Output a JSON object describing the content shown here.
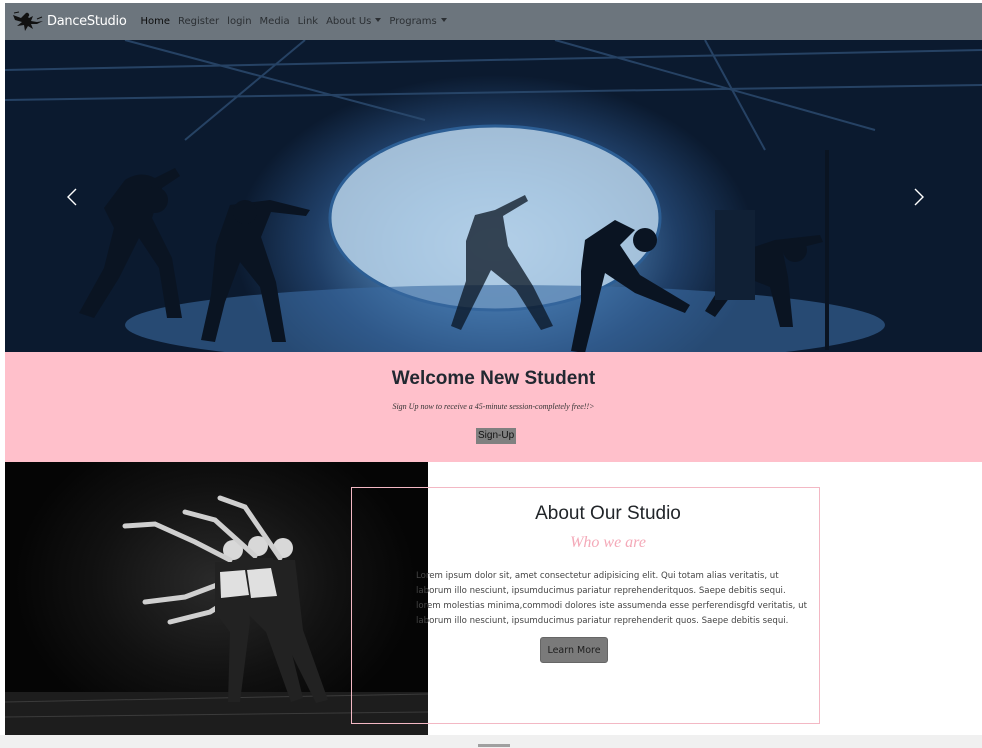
{
  "navbar": {
    "brand": "DanceStudio",
    "logo_icon": "dancer-logo-icon",
    "items": [
      {
        "label": "Home",
        "active": true
      },
      {
        "label": "Register"
      },
      {
        "label": "login"
      },
      {
        "label": "Media"
      },
      {
        "label": "Link"
      },
      {
        "label": "About Us",
        "dropdown": true
      },
      {
        "label": "Programs",
        "dropdown": true
      }
    ]
  },
  "carousel": {
    "prev_icon": "chevron-left-icon",
    "next_icon": "chevron-right-icon"
  },
  "welcome": {
    "title": "Welcome New Student",
    "subtitle": "Sign Up now to receive a 45-minute session-completely free!!>",
    "button": "Sign-Up",
    "bg_color": "#ffc0cb"
  },
  "about": {
    "title": "About Our Studio",
    "subtitle": "Who we are",
    "body_lines": [
      "Lorem ipsum dolor sit, amet consectetur adipisicing elit. Qui totam alias veritatis, ut",
      "laborum illo nesciunt, ipsumducimus pariatur reprehenderitquos. Saepe debitis sequi.",
      "lorem molestias minima,commodi dolores iste assumenda esse perferendisgfd veritatis, ut",
      "laborum illo nesciunt, ipsumducimus pariatur reprehenderit quos. Saepe debitis sequi."
    ],
    "button": "Learn More",
    "accent_color": "#f4a9b8"
  }
}
